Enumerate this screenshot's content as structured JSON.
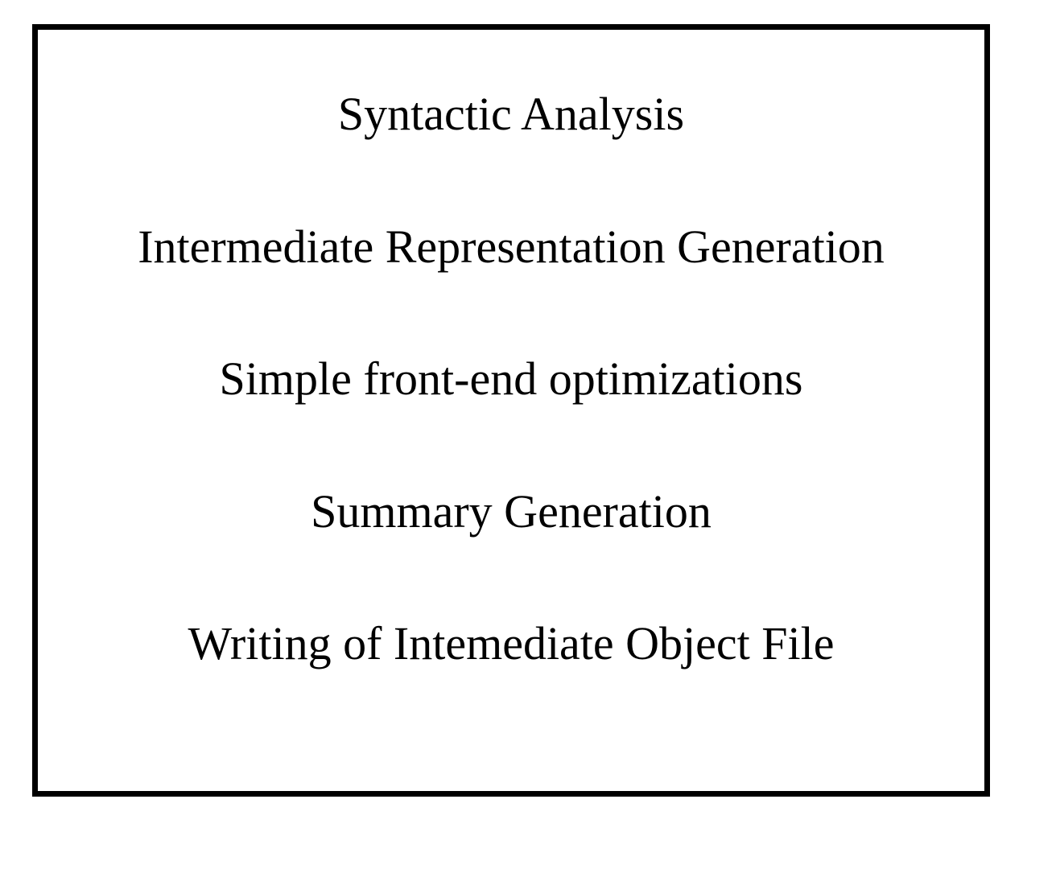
{
  "diagram": {
    "items": [
      "Syntactic Analysis",
      "Intermediate Representation Generation",
      "Simple front-end optimizations",
      "Summary Generation",
      "Writing of Intemediate Object File"
    ]
  }
}
